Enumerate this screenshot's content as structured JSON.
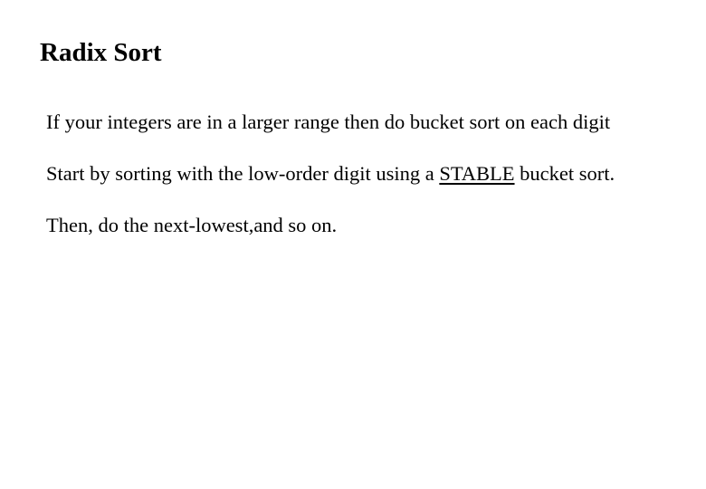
{
  "slide": {
    "title": "Radix Sort",
    "lines": [
      {
        "text": "If your integers are in a larger range then do bucket sort on each digit"
      },
      {
        "before": "Start by sorting with the low-order digit using a ",
        "emphasis": "STABLE",
        "after": " bucket sort."
      },
      {
        "text": "Then, do the next-lowest,and so on."
      }
    ]
  }
}
